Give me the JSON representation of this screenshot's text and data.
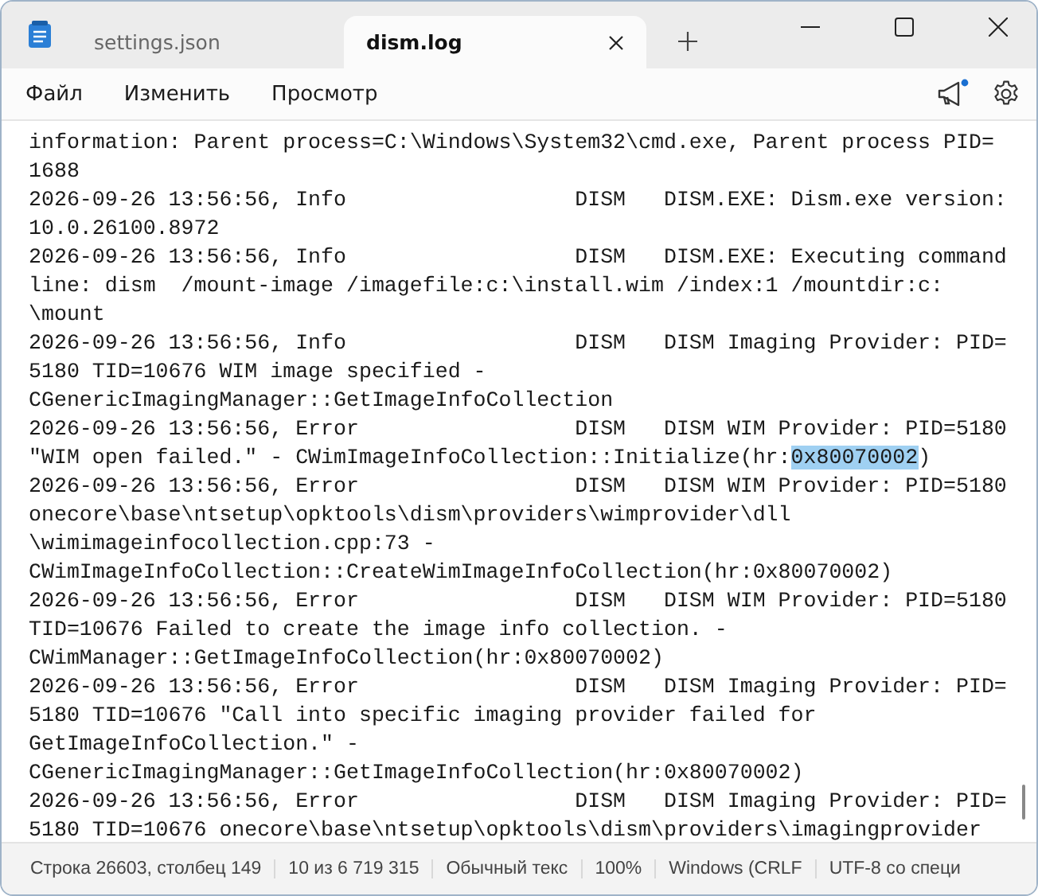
{
  "tabs": [
    {
      "label": "settings.json",
      "selected": false
    },
    {
      "label": "dism.log",
      "selected": true
    }
  ],
  "menu": [
    "Файл",
    "Изменить",
    "Просмотр"
  ],
  "notification_dot": true,
  "lines": [
    {
      "text": "information: Parent process=C:\\Windows\\System32\\cmd.exe, Parent process PID="
    },
    {
      "text": "1688"
    },
    {
      "text": "2026-09-26 13:56:56, Info                  DISM   DISM.EXE: Dism.exe version:"
    },
    {
      "text": "10.0.26100.8972"
    },
    {
      "text": "2026-09-26 13:56:56, Info                  DISM   DISM.EXE: Executing command"
    },
    {
      "text": "line: dism  /mount-image /imagefile:c:\\install.wim /index:1 /mountdir:c:"
    },
    {
      "text": "\\mount"
    },
    {
      "text": "2026-09-26 13:56:56, Info                  DISM   DISM Imaging Provider: PID="
    },
    {
      "text": "5180 TID=10676 WIM image specified -"
    },
    {
      "text": "CGenericImagingManager::GetImageInfoCollection"
    },
    {
      "text": "2026-09-26 13:56:56, Error                 DISM   DISM WIM Provider: PID=5180"
    },
    {
      "text": "\"WIM open failed.\" - CWimImageInfoCollection::Initialize(hr:",
      "selection": "0x80070002",
      "after": ")"
    },
    {
      "text": "2026-09-26 13:56:56, Error                 DISM   DISM WIM Provider: PID=5180"
    },
    {
      "text": "onecore\\base\\ntsetup\\opktools\\dism\\providers\\wimprovider\\dll"
    },
    {
      "text": "\\wimimageinfocollection.cpp:73 -"
    },
    {
      "text": "CWimImageInfoCollection::CreateWimImageInfoCollection(hr:0x80070002)"
    },
    {
      "text": "2026-09-26 13:56:56, Error                 DISM   DISM WIM Provider: PID=5180"
    },
    {
      "text": "TID=10676 Failed to create the image info collection. -"
    },
    {
      "text": "CWimManager::GetImageInfoCollection(hr:0x80070002)"
    },
    {
      "text": "2026-09-26 13:56:56, Error                 DISM   DISM Imaging Provider: PID="
    },
    {
      "text": "5180 TID=10676 \"Call into specific imaging provider failed for"
    },
    {
      "text": "GetImageInfoCollection.\" -"
    },
    {
      "text": "CGenericImagingManager::GetImageInfoCollection(hr:0x80070002)"
    },
    {
      "text": "2026-09-26 13:56:56, Error                 DISM   DISM Imaging Provider: PID="
    },
    {
      "text": "5180 TID=10676 onecore\\base\\ntsetup\\opktools\\dism\\providers\\imagingprovider"
    }
  ],
  "status_bar": [
    "Строка 26603, столбец 149",
    "10 из 6 719 315",
    "Обычный текс",
    "100%",
    "Windows (CRLF",
    "UTF-8 со специ"
  ]
}
